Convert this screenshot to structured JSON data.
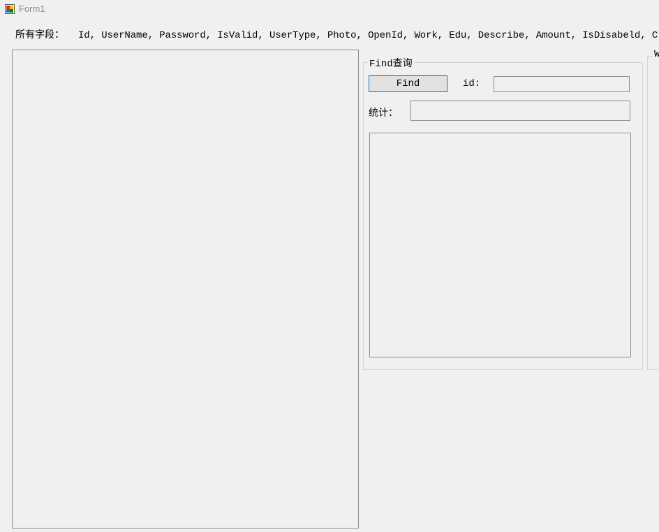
{
  "window": {
    "title": "Form1"
  },
  "fields": {
    "label": "所有字段：",
    "value": "Id, UserName, Password, IsValid, UserType, Photo, OpenId, Work, Edu, Describe, Amount, IsDisabeld, Creat"
  },
  "find_group": {
    "legend_latin": "Find",
    "legend_cjk": "查询",
    "find_button_label": "Find",
    "id_label": "id:",
    "id_value": "",
    "count_label": "统计：",
    "count_value": ""
  },
  "second_group": {
    "legend": "W"
  },
  "colors": {
    "background": "#f0f0f0",
    "button_focus_border": "#0078d7",
    "button_face": "#e1e1e1",
    "control_border": "#8c8c8c"
  }
}
